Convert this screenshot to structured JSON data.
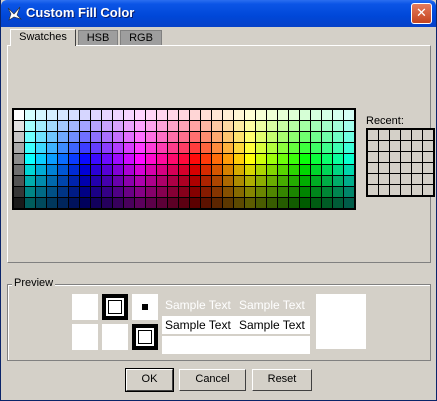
{
  "window": {
    "title": "Custom Fill Color",
    "close_glyph": "✕",
    "icon": "app-icon"
  },
  "tabs": [
    {
      "label": "Swatches",
      "selected": true
    },
    {
      "label": "HSB",
      "selected": false
    },
    {
      "label": "RGB",
      "selected": false
    }
  ],
  "swatches": {
    "columns": 31,
    "rows": 9
  },
  "recent": {
    "label": "Recent:",
    "columns": 6,
    "rows": 6
  },
  "preview": {
    "label": "Preview",
    "sample_text": "Sample Text",
    "sample_text_color": "#ffffff",
    "sample_text_color_on_white": "#000000"
  },
  "buttons": {
    "ok": "OK",
    "cancel": "Cancel",
    "reset": "Reset"
  }
}
